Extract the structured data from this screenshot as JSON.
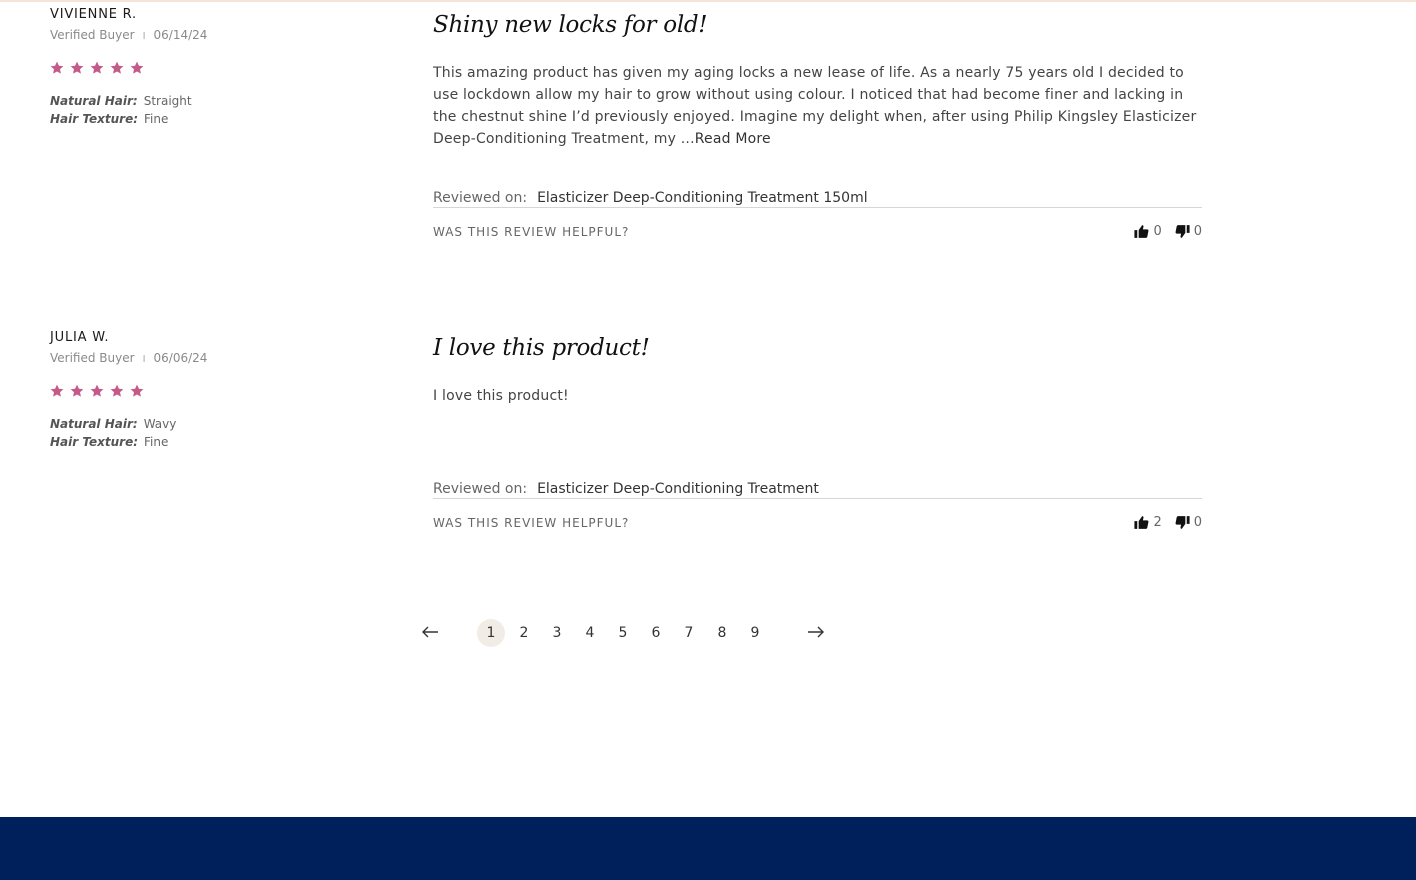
{
  "colors": {
    "star": "#c55a8a",
    "footer": "#00205b",
    "active_page_bg": "#f1ece6"
  },
  "reviews": [
    {
      "name": "VIVIENNE R.",
      "status": "Verified Buyer",
      "separator": "I",
      "date": "06/14/24",
      "rating": 5,
      "natural_hair_label": "Natural Hair:",
      "natural_hair": "Straight",
      "hair_texture_label": "Hair Texture:",
      "hair_texture": "Fine",
      "title": "Shiny new locks for old!",
      "body": "This amazing product has given my aging locks a new lease of life. As a nearly 75 years old I decided to use lockdown allow my hair to grow without using colour. I noticed that had become finer and lacking in the chestnut shine I’d previously enjoyed. Imagine my delight when, after using Philip Kingsley Elasticizer Deep-Conditioning Treatment, my ...",
      "read_more": "Read More",
      "reviewed_on_label": "Reviewed on:",
      "reviewed_on": "Elasticizer Deep-Conditioning Treatment 150ml",
      "helpful_label": "WAS THIS REVIEW HELPFUL?",
      "thumbs_up": "0",
      "thumbs_down": "0"
    },
    {
      "name": "JULIA W.",
      "status": "Verified Buyer",
      "separator": "I",
      "date": "06/06/24",
      "rating": 5,
      "natural_hair_label": "Natural Hair:",
      "natural_hair": "Wavy",
      "hair_texture_label": "Hair Texture:",
      "hair_texture": "Fine",
      "title": "I love this product!",
      "body": "I love this product!",
      "read_more": "",
      "reviewed_on_label": "Reviewed on:",
      "reviewed_on": "Elasticizer Deep-Conditioning Treatment",
      "helpful_label": "WAS THIS REVIEW HELPFUL?",
      "thumbs_up": "2",
      "thumbs_down": "0"
    }
  ],
  "pagination": {
    "prev_icon": "arrow-left-icon",
    "next_icon": "arrow-right-icon",
    "pages": [
      "1",
      "2",
      "3",
      "4",
      "5",
      "6",
      "7",
      "8",
      "9"
    ],
    "current": "1"
  }
}
